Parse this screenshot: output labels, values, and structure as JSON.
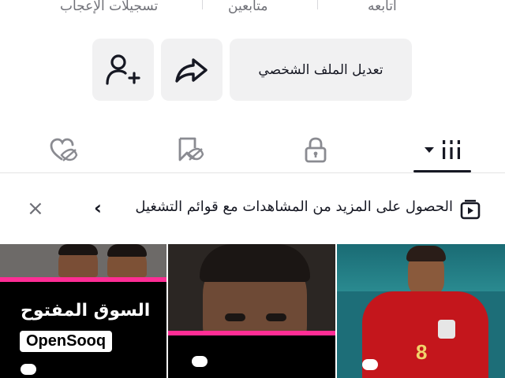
{
  "stats": {
    "following_label": "أتابعه",
    "followers_label": "متابعين",
    "likes_label": "تسجيلات الإعجاب"
  },
  "actions": {
    "edit_profile_label": "تعديل الملف الشخصي",
    "share_icon": "share-arrow-icon",
    "add_friend_icon": "add-user-icon"
  },
  "tabs": [
    {
      "name": "videos",
      "icon": "grid-bars-icon",
      "selected": true,
      "has_dropdown": true
    },
    {
      "name": "private",
      "icon": "lock-icon",
      "selected": false
    },
    {
      "name": "favorites",
      "icon": "bookmark-hidden-icon",
      "selected": false
    },
    {
      "name": "liked",
      "icon": "heart-hidden-icon",
      "selected": false
    }
  ],
  "banner": {
    "text": "الحصول على المزيد من المشاهدات مع قوائم التشغيل",
    "chevron": "‹",
    "close": "×"
  },
  "videos": [
    {
      "type": "player-photo",
      "brand_text": "",
      "jersey_number": "8"
    },
    {
      "type": "player-closeup",
      "brand_text": ""
    },
    {
      "type": "ad",
      "brand_text_ar": "السوق المفتوح",
      "brand_text_en": "OpenSooq"
    }
  ],
  "colors": {
    "text_primary": "#161823",
    "text_secondary": "#6f7077",
    "button_bg": "#f1f1f2",
    "accent_pink": "#ff2d95"
  }
}
